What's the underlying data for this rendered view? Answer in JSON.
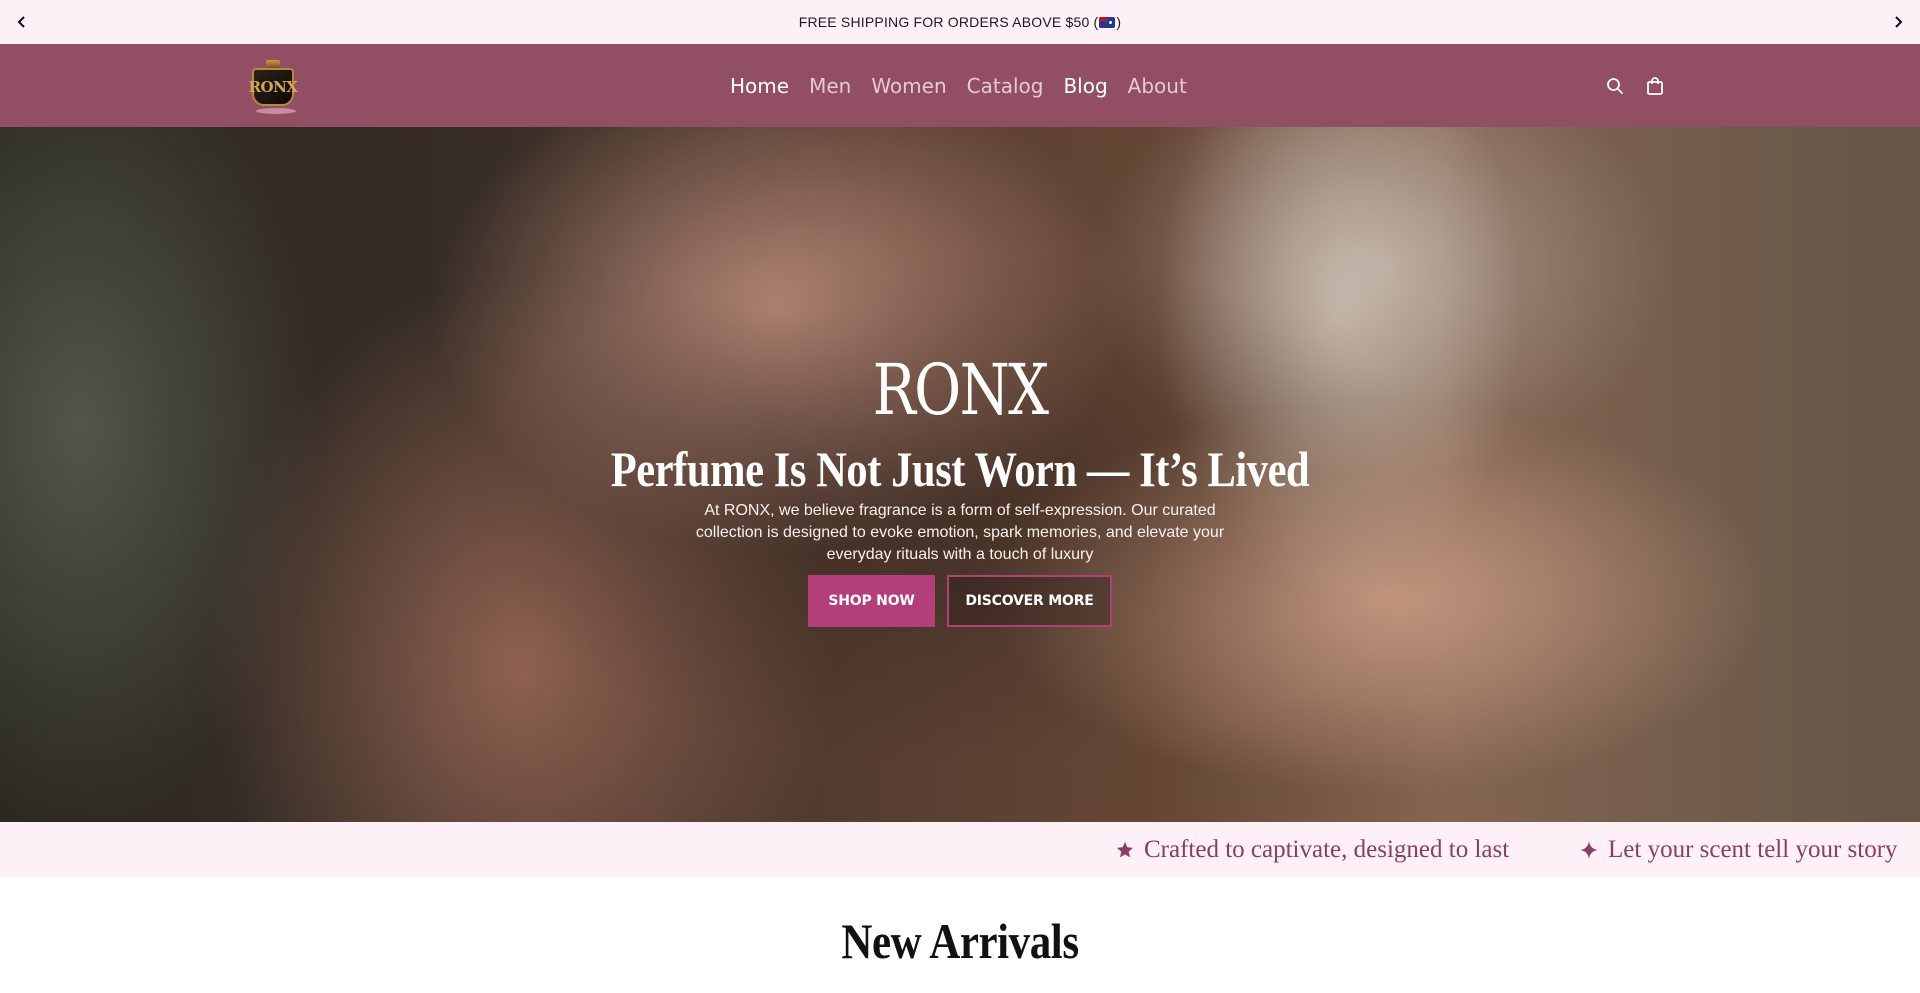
{
  "announcement": {
    "text": "FREE SHIPPING FOR ORDERS ABOVE $50 (",
    "text_end": ")",
    "flag_icon": "australia-flag-icon",
    "prev_icon": "chevron-left-icon",
    "next_icon": "chevron-right-icon"
  },
  "header": {
    "background": "#924f63",
    "logo_text": "RONX",
    "nav": [
      {
        "label": "Home"
      },
      {
        "label": "Men"
      },
      {
        "label": "Women"
      },
      {
        "label": "Catalog"
      },
      {
        "label": "Blog"
      },
      {
        "label": "About"
      }
    ],
    "search_icon": "search-icon",
    "cart_icon": "shopping-bag-icon"
  },
  "hero": {
    "title": "RONX",
    "subtitle": "Perfume Is Not Just Worn — It’s Lived",
    "text": "At RONX, we believe fragrance is a form of self-expression. Our curated collection is designed to evoke emotion, spark memories, and elevate your everyday rituals with a touch of luxury",
    "primary_button": "SHOP NOW",
    "secondary_button": "DISCOVER MORE",
    "accent": "#b23f79"
  },
  "marquee": {
    "items": [
      {
        "icon": "star-icon",
        "text": "Crafted to captivate, designed to last"
      },
      {
        "icon": "sparkle-icon",
        "text": "Let your scent tell your story"
      }
    ],
    "color": "#8a3e63"
  },
  "new_arrivals": {
    "title": "New Arrivals"
  }
}
